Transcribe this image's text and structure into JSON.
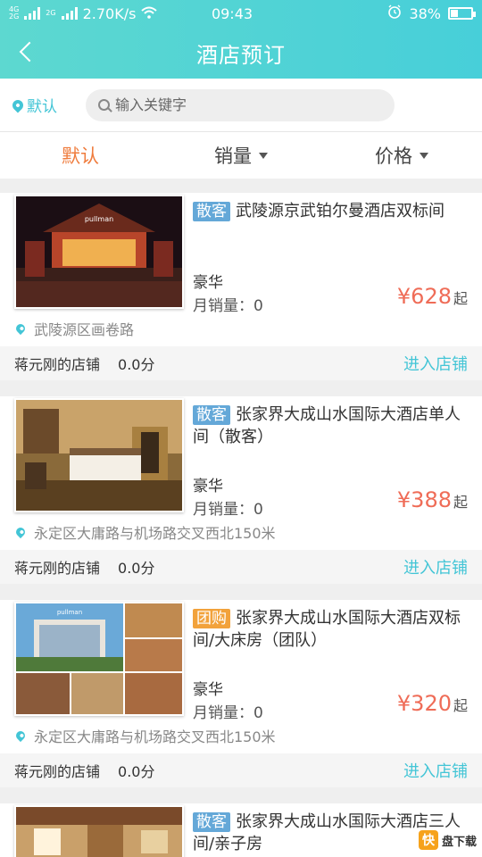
{
  "status_bar": {
    "network_left": "4G",
    "network_left2": "2G",
    "network_right": "2G",
    "speed": "2.70K/s",
    "time": "09:43",
    "battery": "38%",
    "battery_level": 0.38
  },
  "nav": {
    "title": "酒店预订",
    "back_icon": "chevron-left-icon"
  },
  "search": {
    "location_label": "默认",
    "placeholder": "输入关键字",
    "value": ""
  },
  "sort_tabs": [
    {
      "label": "默认",
      "active": true
    },
    {
      "label": "销量",
      "active": false
    },
    {
      "label": "价格",
      "active": false
    }
  ],
  "hotels": [
    {
      "badge": "散客",
      "badge_color": "#64a8d8",
      "name": "武陵源京武铂尔曼酒店双标间",
      "grade": "豪华",
      "sales": "月销量：0",
      "price": "¥628",
      "price_suffix": "起",
      "address": "武陵源区画卷路",
      "shop_name": "蒋元刚的店铺",
      "score": "0.0分",
      "enter": "进入店铺",
      "image_sign": "pullman"
    },
    {
      "badge": "散客",
      "badge_color": "#64a8d8",
      "name": "张家界大成山水国际大酒店单人间（散客）",
      "grade": "豪华",
      "sales": "月销量：0",
      "price": "¥388",
      "price_suffix": "起",
      "address": "永定区大庸路与机场路交叉西北150米",
      "shop_name": "蒋元刚的店铺",
      "score": "0.0分",
      "enter": "进入店铺",
      "image_sign": ""
    },
    {
      "badge": "团购",
      "badge_color": "#f2a23b",
      "name": "张家界大成山水国际大酒店双标间/大床房（团队）",
      "grade": "豪华",
      "sales": "月销量：0",
      "price": "¥320",
      "price_suffix": "起",
      "address": "永定区大庸路与机场路交叉西北150米",
      "shop_name": "蒋元刚的店铺",
      "score": "0.0分",
      "enter": "进入店铺",
      "image_sign": "pullman"
    },
    {
      "badge": "散客",
      "badge_color": "#64a8d8",
      "name": "张家界大成山水国际大酒店三人间/亲子房",
      "grade": "",
      "sales": "",
      "price": "",
      "price_suffix": "",
      "address": "",
      "shop_name": "",
      "score": "",
      "enter": "",
      "image_sign": ""
    }
  ],
  "watermark": {
    "logo": "快",
    "text": "盘下载"
  }
}
